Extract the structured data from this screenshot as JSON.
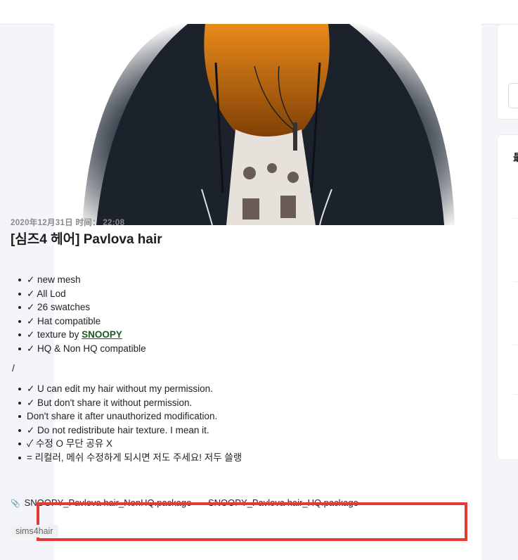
{
  "post": {
    "date": "2020年12月31日 时间： 22:08",
    "title": "[심즈4 헤어] Pavlova hair",
    "features": [
      "✓ new mesh",
      "✓ All Lod",
      "✓ 26 swatches",
      "✓ Hat compatible",
      "✓ texture by ",
      "✓ HQ & Non HQ compatible"
    ],
    "texture_author": "SNOOPY",
    "separator": "/",
    "rules": [
      "✓ U can edit my hair without my permission.",
      "✓ But don't share it without permission.",
      "Don't share it after unauthorized modification.",
      "✓ Do not redistribute hair texture. I mean it.",
      "✓ 수정 O 무단 공유 X",
      "= 리컬러, 메쉬 수정하게 되시면 저도 주세요! 저두 쓸랭"
    ],
    "attachments": [
      "SNOOPY_Pavlova hair_NonHQ.package",
      "SNOOPY_Pavlova hair_HQ.package"
    ],
    "tag": "sims4hair"
  },
  "sidebar": {
    "second_card_heading": "最"
  },
  "colors": {
    "highlight_border": "#e53935",
    "link": "#1e5a20",
    "page_bg": "#f4f5f9"
  },
  "icons": {
    "attachment": "paperclip-icon"
  }
}
